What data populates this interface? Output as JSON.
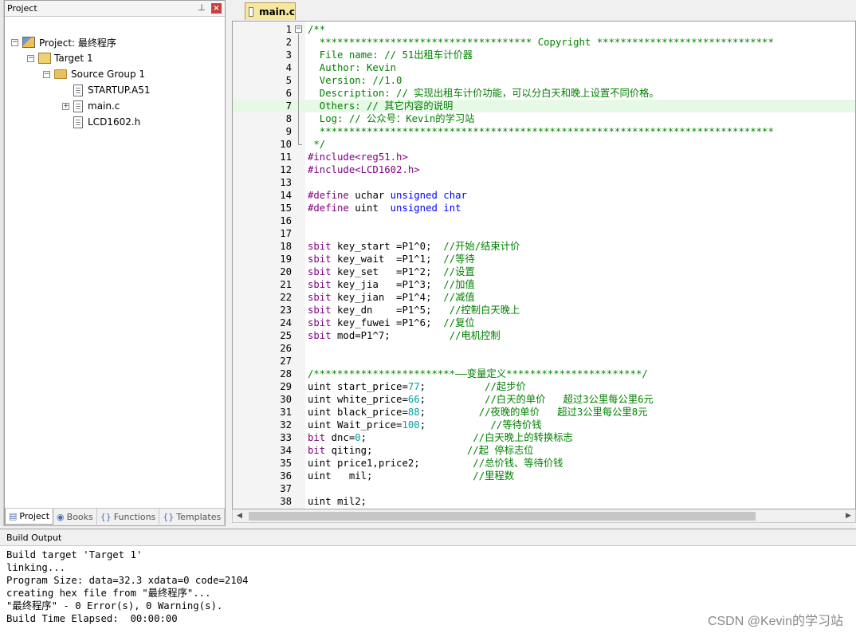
{
  "project_panel": {
    "title": "Project",
    "pin_icon": "pin-icon",
    "close_label": "×",
    "tree": [
      {
        "label": "Project: 最终程序",
        "kind": "project",
        "expander": "−",
        "indent": 0
      },
      {
        "label": "Target 1",
        "kind": "target",
        "expander": "−",
        "indent": 1
      },
      {
        "label": "Source Group 1",
        "kind": "folder",
        "expander": "−",
        "indent": 2
      },
      {
        "label": "STARTUP.A51",
        "kind": "file",
        "expander": "",
        "indent": 3
      },
      {
        "label": "main.c",
        "kind": "file",
        "expander": "+",
        "indent": 3
      },
      {
        "label": "LCD1602.h",
        "kind": "file",
        "expander": "",
        "indent": 3
      }
    ],
    "tabs": [
      {
        "label": "Project",
        "icon": "▤",
        "active": true
      },
      {
        "label": "Books",
        "icon": "◉",
        "active": false
      },
      {
        "label": "Functions",
        "icon": "{}",
        "active": false
      },
      {
        "label": "Templates",
        "icon": "{}",
        "active": false
      }
    ]
  },
  "editor": {
    "active_tab": "main.c",
    "highlighted_line": 7,
    "lines": [
      [
        {
          "t": "/**",
          "c": "comment"
        }
      ],
      [
        {
          "t": "  ************************************ Copyright ******************************",
          "c": "comment"
        }
      ],
      [
        {
          "t": "  File name: // 51出租车计价器",
          "c": "comment"
        }
      ],
      [
        {
          "t": "  Author: Kevin",
          "c": "comment"
        }
      ],
      [
        {
          "t": "  Version: //1.0",
          "c": "comment"
        }
      ],
      [
        {
          "t": "  Description: // 实现出租车计价功能，可以分白天和晚上设置不同价格。",
          "c": "comment"
        }
      ],
      [
        {
          "t": "  Others: // 其它内容的说明",
          "c": "comment"
        }
      ],
      [
        {
          "t": "  Log: // 公众号：Kevin的学习站",
          "c": "comment"
        }
      ],
      [
        {
          "t": "  *****************************************************************************",
          "c": "comment"
        }
      ],
      [
        {
          "t": " */",
          "c": "comment"
        }
      ],
      [
        {
          "t": "#include<reg51.h>",
          "c": "pre"
        }
      ],
      [
        {
          "t": "#include<LCD1602.h>",
          "c": "pre"
        }
      ],
      [],
      [
        {
          "t": "#define",
          "c": "define"
        },
        {
          "t": " uchar ",
          "c": "plain"
        },
        {
          "t": "unsigned",
          "c": "keyword"
        },
        {
          "t": " ",
          "c": "plain"
        },
        {
          "t": "char",
          "c": "keyword"
        }
      ],
      [
        {
          "t": "#define",
          "c": "define"
        },
        {
          "t": " uint  ",
          "c": "plain"
        },
        {
          "t": "unsigned",
          "c": "keyword"
        },
        {
          "t": " ",
          "c": "plain"
        },
        {
          "t": "int",
          "c": "keyword"
        }
      ],
      [],
      [],
      [
        {
          "t": "sbit",
          "c": "define"
        },
        {
          "t": " key_start =P1^0;  ",
          "c": "plain"
        },
        {
          "t": "//开始/结束计价",
          "c": "comment"
        }
      ],
      [
        {
          "t": "sbit",
          "c": "define"
        },
        {
          "t": " key_wait  =P1^1;  ",
          "c": "plain"
        },
        {
          "t": "//等待",
          "c": "comment"
        }
      ],
      [
        {
          "t": "sbit",
          "c": "define"
        },
        {
          "t": " key_set   =P1^2;  ",
          "c": "plain"
        },
        {
          "t": "//设置",
          "c": "comment"
        }
      ],
      [
        {
          "t": "sbit",
          "c": "define"
        },
        {
          "t": " key_jia   =P1^3;  ",
          "c": "plain"
        },
        {
          "t": "//加值",
          "c": "comment"
        }
      ],
      [
        {
          "t": "sbit",
          "c": "define"
        },
        {
          "t": " key_jian  =P1^4;  ",
          "c": "plain"
        },
        {
          "t": "//减值",
          "c": "comment"
        }
      ],
      [
        {
          "t": "sbit",
          "c": "define"
        },
        {
          "t": " key_dn    =P1^5;   ",
          "c": "plain"
        },
        {
          "t": "//控制白天晚上",
          "c": "comment"
        }
      ],
      [
        {
          "t": "sbit",
          "c": "define"
        },
        {
          "t": " key_fuwei =P1^6;  ",
          "c": "plain"
        },
        {
          "t": "//复位",
          "c": "comment"
        }
      ],
      [
        {
          "t": "sbit",
          "c": "define"
        },
        {
          "t": " mod=P1^7;          ",
          "c": "plain"
        },
        {
          "t": "//电机控制",
          "c": "comment"
        }
      ],
      [],
      [],
      [
        {
          "t": "/************************——变量定义***********************/",
          "c": "comment"
        }
      ],
      [
        {
          "t": "uint start_price=",
          "c": "plain"
        },
        {
          "t": "77",
          "c": "number"
        },
        {
          "t": ";          ",
          "c": "plain"
        },
        {
          "t": "//起步价",
          "c": "comment"
        }
      ],
      [
        {
          "t": "uint white_price=",
          "c": "plain"
        },
        {
          "t": "66",
          "c": "number"
        },
        {
          "t": ";          ",
          "c": "plain"
        },
        {
          "t": "//白天的单价   超过3公里每公里6元",
          "c": "comment"
        }
      ],
      [
        {
          "t": "uint black_price=",
          "c": "plain"
        },
        {
          "t": "88",
          "c": "number"
        },
        {
          "t": ";         ",
          "c": "plain"
        },
        {
          "t": "//夜晚的单价   超过3公里每公里8元",
          "c": "comment"
        }
      ],
      [
        {
          "t": "uint Wait_price=",
          "c": "plain"
        },
        {
          "t": "100",
          "c": "number"
        },
        {
          "t": ";           ",
          "c": "plain"
        },
        {
          "t": "//等待价钱",
          "c": "comment"
        }
      ],
      [
        {
          "t": "bit",
          "c": "define"
        },
        {
          "t": " dnc=",
          "c": "plain"
        },
        {
          "t": "0",
          "c": "number"
        },
        {
          "t": ";                  ",
          "c": "plain"
        },
        {
          "t": "//白天晚上的转换标志",
          "c": "comment"
        }
      ],
      [
        {
          "t": "bit",
          "c": "define"
        },
        {
          "t": " qiting;                ",
          "c": "plain"
        },
        {
          "t": "//起 停标志位",
          "c": "comment"
        }
      ],
      [
        {
          "t": "uint price1,price2;         ",
          "c": "plain"
        },
        {
          "t": "//总价钱、等待价钱",
          "c": "comment"
        }
      ],
      [
        {
          "t": "uint   mil;                 ",
          "c": "plain"
        },
        {
          "t": "//里程数",
          "c": "comment"
        }
      ],
      [],
      [
        {
          "t": "uint mil2;",
          "c": "plain"
        }
      ]
    ]
  },
  "build_output": {
    "title": "Build Output",
    "lines": [
      "Build target 'Target 1'",
      "linking...",
      "Program Size: data=32.3 xdata=0 code=2104",
      "creating hex file from \"最终程序\"...",
      "\"最终程序\" - 0 Error(s), 0 Warning(s).",
      "Build Time Elapsed:  00:00:00"
    ]
  },
  "watermark": "CSDN @Kevin的学习站"
}
